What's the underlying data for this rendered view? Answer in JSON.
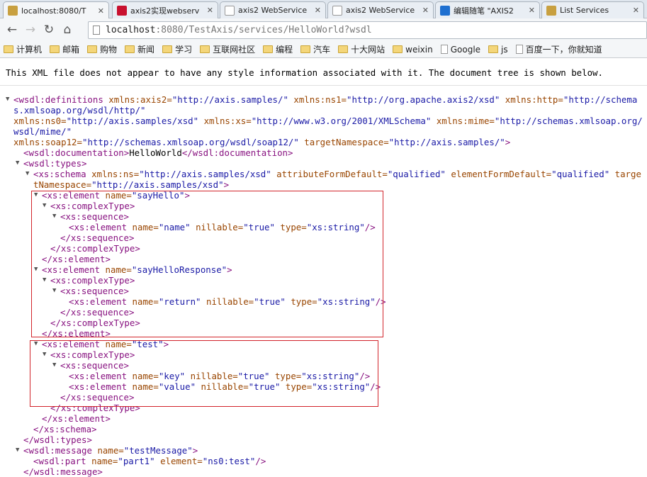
{
  "tabs": [
    {
      "title": "localhost:8080/T",
      "icon": "tomcat-icon",
      "active": true,
      "color": "#c8a040"
    },
    {
      "title": "axis2实现webserv",
      "icon": "csdn-icon",
      "color": "#c8102e"
    },
    {
      "title": "axis2 WebService",
      "icon": "page-icon",
      "color": "#ffffff"
    },
    {
      "title": "axis2 WebService",
      "icon": "page-icon",
      "color": "#ffffff"
    },
    {
      "title": "编辑随笔 \"AXIS2",
      "icon": "cnblogs-icon",
      "color": "#1e6fd0"
    },
    {
      "title": "List Services",
      "icon": "tomcat-icon",
      "color": "#c8a040"
    }
  ],
  "url": {
    "host": "localhost",
    "rest": ":8080/TestAxis/services/HelloWorld?wsdl"
  },
  "bookmarks": [
    {
      "label": "计算机",
      "type": "folder"
    },
    {
      "label": "邮箱",
      "type": "folder"
    },
    {
      "label": "购物",
      "type": "folder"
    },
    {
      "label": "新闻",
      "type": "folder"
    },
    {
      "label": "学习",
      "type": "folder"
    },
    {
      "label": "互联网社区",
      "type": "folder"
    },
    {
      "label": "编程",
      "type": "folder"
    },
    {
      "label": "汽车",
      "type": "folder"
    },
    {
      "label": "十大网站",
      "type": "folder"
    },
    {
      "label": "weixin",
      "type": "folder"
    },
    {
      "label": "Google",
      "type": "page"
    },
    {
      "label": "js",
      "type": "folder"
    },
    {
      "label": "百度一下，你就知道",
      "type": "page"
    }
  ],
  "info": "This XML file does not appear to have any style information associated with it. The document tree is shown below.",
  "lines": [
    {
      "l": 0,
      "t": 1,
      "k": [
        [
          "tg",
          "<wsdl:definitions "
        ],
        [
          "an",
          "xmlns:axis2="
        ],
        [
          "av",
          "\"http://axis.samples/\" "
        ],
        [
          "an",
          "xmlns:ns1="
        ],
        [
          "av",
          "\"http://org.apache.axis2/xsd\" "
        ],
        [
          "an",
          "xmlns:http="
        ],
        [
          "av",
          "\"http://schemas.xmlsoap.org/wsdl/http/\""
        ]
      ]
    },
    {
      "l": 0,
      "t": 0,
      "k": [
        [
          "an",
          "xmlns:ns0="
        ],
        [
          "av",
          "\"http://axis.samples/xsd\" "
        ],
        [
          "an",
          "xmlns:xs="
        ],
        [
          "av",
          "\"http://www.w3.org/2001/XMLSchema\" "
        ],
        [
          "an",
          "xmlns:mime="
        ],
        [
          "av",
          "\"http://schemas.xmlsoap.org/wsdl/mime/\""
        ]
      ]
    },
    {
      "l": 0,
      "t": 0,
      "k": [
        [
          "an",
          "xmlns:soap12="
        ],
        [
          "av",
          "\"http://schemas.xmlsoap.org/wsdl/soap12/\" "
        ],
        [
          "an",
          "targetNamespace="
        ],
        [
          "av",
          "\"http://axis.samples/\""
        ],
        [
          "tg",
          ">"
        ]
      ]
    },
    {
      "l": 1,
      "t": 0,
      "k": [
        [
          "tg",
          "<wsdl:documentation>"
        ],
        [
          "tx",
          "HelloWorld"
        ],
        [
          "tg",
          "</wsdl:documentation>"
        ]
      ]
    },
    {
      "l": 1,
      "t": 1,
      "k": [
        [
          "tg",
          "<wsdl:types>"
        ]
      ]
    },
    {
      "l": 2,
      "t": 1,
      "k": [
        [
          "tg",
          "<xs:schema "
        ],
        [
          "an",
          "xmlns:ns="
        ],
        [
          "av",
          "\"http://axis.samples/xsd\" "
        ],
        [
          "an",
          "attributeFormDefault="
        ],
        [
          "av",
          "\"qualified\" "
        ],
        [
          "an",
          "elementFormDefault="
        ],
        [
          "av",
          "\"qualified\" "
        ],
        [
          "an",
          "targetNamespace="
        ],
        [
          "av",
          "\"http://axis.samples/xsd\""
        ],
        [
          "tg",
          ">"
        ]
      ]
    },
    {
      "l": 3,
      "t": 1,
      "k": [
        [
          "tg",
          "<xs:element "
        ],
        [
          "an",
          "name="
        ],
        [
          "av",
          "\"sayHello\""
        ],
        [
          "tg",
          ">"
        ]
      ]
    },
    {
      "l": 4,
      "t": 1,
      "k": [
        [
          "tg",
          "<xs:complexType>"
        ]
      ]
    },
    {
      "l": 5,
      "t": 1,
      "k": [
        [
          "tg",
          "<xs:sequence>"
        ]
      ]
    },
    {
      "l": 6,
      "t": 0,
      "k": [
        [
          "tg",
          "<xs:element "
        ],
        [
          "an",
          "name="
        ],
        [
          "av",
          "\"name\" "
        ],
        [
          "an",
          "nillable="
        ],
        [
          "av",
          "\"true\" "
        ],
        [
          "an",
          "type="
        ],
        [
          "av",
          "\"xs:string\""
        ],
        [
          "tg",
          "/>"
        ]
      ]
    },
    {
      "l": 5,
      "t": 0,
      "k": [
        [
          "tg",
          "</xs:sequence>"
        ]
      ]
    },
    {
      "l": 4,
      "t": 0,
      "k": [
        [
          "tg",
          "</xs:complexType>"
        ]
      ]
    },
    {
      "l": 3,
      "t": 0,
      "k": [
        [
          "tg",
          "</xs:element>"
        ]
      ]
    },
    {
      "l": 3,
      "t": 1,
      "k": [
        [
          "tg",
          "<xs:element "
        ],
        [
          "an",
          "name="
        ],
        [
          "av",
          "\"sayHelloResponse\""
        ],
        [
          "tg",
          ">"
        ]
      ]
    },
    {
      "l": 4,
      "t": 1,
      "k": [
        [
          "tg",
          "<xs:complexType>"
        ]
      ]
    },
    {
      "l": 5,
      "t": 1,
      "k": [
        [
          "tg",
          "<xs:sequence>"
        ]
      ]
    },
    {
      "l": 6,
      "t": 0,
      "k": [
        [
          "tg",
          "<xs:element "
        ],
        [
          "an",
          "name="
        ],
        [
          "av",
          "\"return\" "
        ],
        [
          "an",
          "nillable="
        ],
        [
          "av",
          "\"true\" "
        ],
        [
          "an",
          "type="
        ],
        [
          "av",
          "\"xs:string\""
        ],
        [
          "tg",
          "/>"
        ]
      ]
    },
    {
      "l": 5,
      "t": 0,
      "k": [
        [
          "tg",
          "</xs:sequence>"
        ]
      ]
    },
    {
      "l": 4,
      "t": 0,
      "k": [
        [
          "tg",
          "</xs:complexType>"
        ]
      ]
    },
    {
      "l": 3,
      "t": 0,
      "k": [
        [
          "tg",
          "</xs:element>"
        ]
      ]
    },
    {
      "l": 3,
      "t": 1,
      "k": [
        [
          "tg",
          "<xs:element "
        ],
        [
          "an",
          "name="
        ],
        [
          "av",
          "\"test\""
        ],
        [
          "tg",
          ">"
        ]
      ]
    },
    {
      "l": 4,
      "t": 1,
      "k": [
        [
          "tg",
          "<xs:complexType>"
        ]
      ]
    },
    {
      "l": 5,
      "t": 1,
      "k": [
        [
          "tg",
          "<xs:sequence>"
        ]
      ]
    },
    {
      "l": 6,
      "t": 0,
      "k": [
        [
          "tg",
          "<xs:element "
        ],
        [
          "an",
          "name="
        ],
        [
          "av",
          "\"key\" "
        ],
        [
          "an",
          "nillable="
        ],
        [
          "av",
          "\"true\" "
        ],
        [
          "an",
          "type="
        ],
        [
          "av",
          "\"xs:string\""
        ],
        [
          "tg",
          "/>"
        ]
      ]
    },
    {
      "l": 6,
      "t": 0,
      "k": [
        [
          "tg",
          "<xs:element "
        ],
        [
          "an",
          "name="
        ],
        [
          "av",
          "\"value\" "
        ],
        [
          "an",
          "nillable="
        ],
        [
          "av",
          "\"true\" "
        ],
        [
          "an",
          "type="
        ],
        [
          "av",
          "\"xs:string\""
        ],
        [
          "tg",
          "/>"
        ]
      ]
    },
    {
      "l": 5,
      "t": 0,
      "k": [
        [
          "tg",
          "</xs:sequence>"
        ]
      ]
    },
    {
      "l": 4,
      "t": 0,
      "k": [
        [
          "tg",
          "</xs:complexType>"
        ]
      ]
    },
    {
      "l": 3,
      "t": 0,
      "k": [
        [
          "tg",
          "</xs:element>"
        ]
      ]
    },
    {
      "l": 2,
      "t": 0,
      "k": [
        [
          "tg",
          "</xs:schema>"
        ]
      ]
    },
    {
      "l": 1,
      "t": 0,
      "k": [
        [
          "tg",
          "</wsdl:types>"
        ]
      ]
    },
    {
      "l": 1,
      "t": 1,
      "k": [
        [
          "tg",
          "<wsdl:message "
        ],
        [
          "an",
          "name="
        ],
        [
          "av",
          "\"testMessage\""
        ],
        [
          "tg",
          ">"
        ]
      ]
    },
    {
      "l": 2,
      "t": 0,
      "k": [
        [
          "tg",
          "<wsdl:part "
        ],
        [
          "an",
          "name="
        ],
        [
          "av",
          "\"part1\" "
        ],
        [
          "an",
          "element="
        ],
        [
          "av",
          "\"ns0:test\""
        ],
        [
          "tg",
          "/>"
        ]
      ]
    },
    {
      "l": 1,
      "t": 0,
      "k": [
        [
          "tg",
          "</wsdl:message>"
        ]
      ]
    }
  ],
  "highlight_color": "#d2232a"
}
